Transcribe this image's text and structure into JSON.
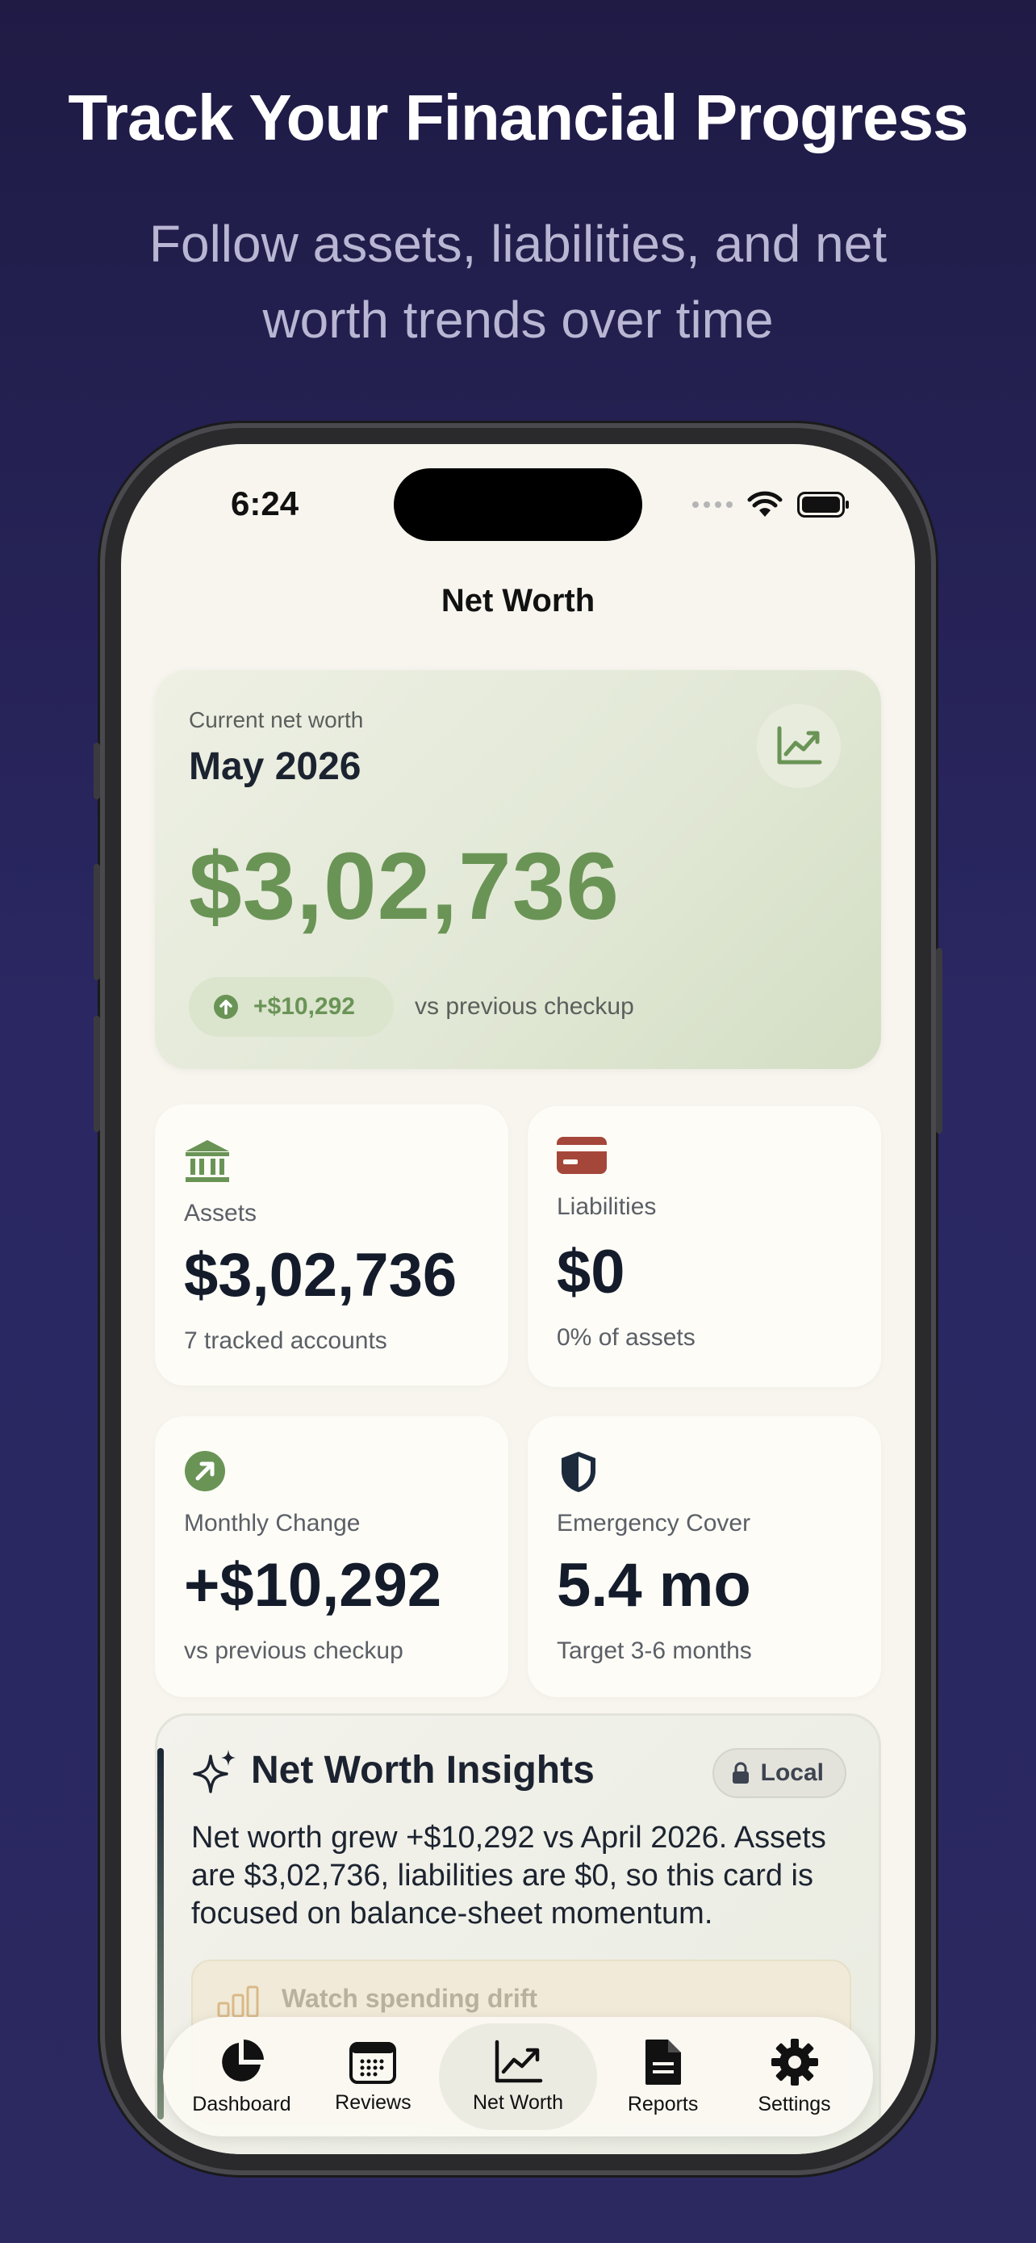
{
  "hero": {
    "title": "Track Your Financial Progress",
    "subtitle": "Follow assets, liabilities, and net worth trends over time"
  },
  "status_bar": {
    "time": "6:24"
  },
  "screen": {
    "title": "Net Worth"
  },
  "net_worth_card": {
    "label": "Current net worth",
    "period": "May 2026",
    "value": "$3,02,736",
    "change": "+$10,292",
    "change_note": "vs previous checkup",
    "icon": "chart-up-icon"
  },
  "tiles": [
    {
      "icon": "bank-icon",
      "label": "Assets",
      "value": "$3,02,736",
      "sub": "7 tracked accounts"
    },
    {
      "icon": "credit-card-icon",
      "label": "Liabilities",
      "value": "$0",
      "sub": "0% of assets"
    },
    {
      "icon": "arrow-up-right-icon",
      "label": "Monthly Change",
      "value": "+$10,292",
      "sub": "vs previous checkup"
    },
    {
      "icon": "shield-icon",
      "label": "Emergency Cover",
      "value": "5.4 mo",
      "sub": "Target 3-6 months"
    }
  ],
  "insights": {
    "title": "Net Worth Insights",
    "badge": "Local",
    "text": "Net worth grew +$10,292 vs April 2026. Assets are $3,02,736, liabilities are $0, so this card is focused on balance-sheet momentum.",
    "tip_title": "Watch spending drift"
  },
  "tabbar": {
    "tabs": [
      {
        "label": "Dashboard",
        "icon": "pie-chart-icon"
      },
      {
        "label": "Reviews",
        "icon": "calendar-icon"
      },
      {
        "label": "Net Worth",
        "icon": "chart-up-icon",
        "active": true
      },
      {
        "label": "Reports",
        "icon": "document-icon"
      },
      {
        "label": "Settings",
        "icon": "gear-icon"
      }
    ]
  },
  "colors": {
    "accent_green": "#6a9456",
    "liability_red": "#a5463a",
    "ink": "#141c2b",
    "background": "#2a2762"
  }
}
